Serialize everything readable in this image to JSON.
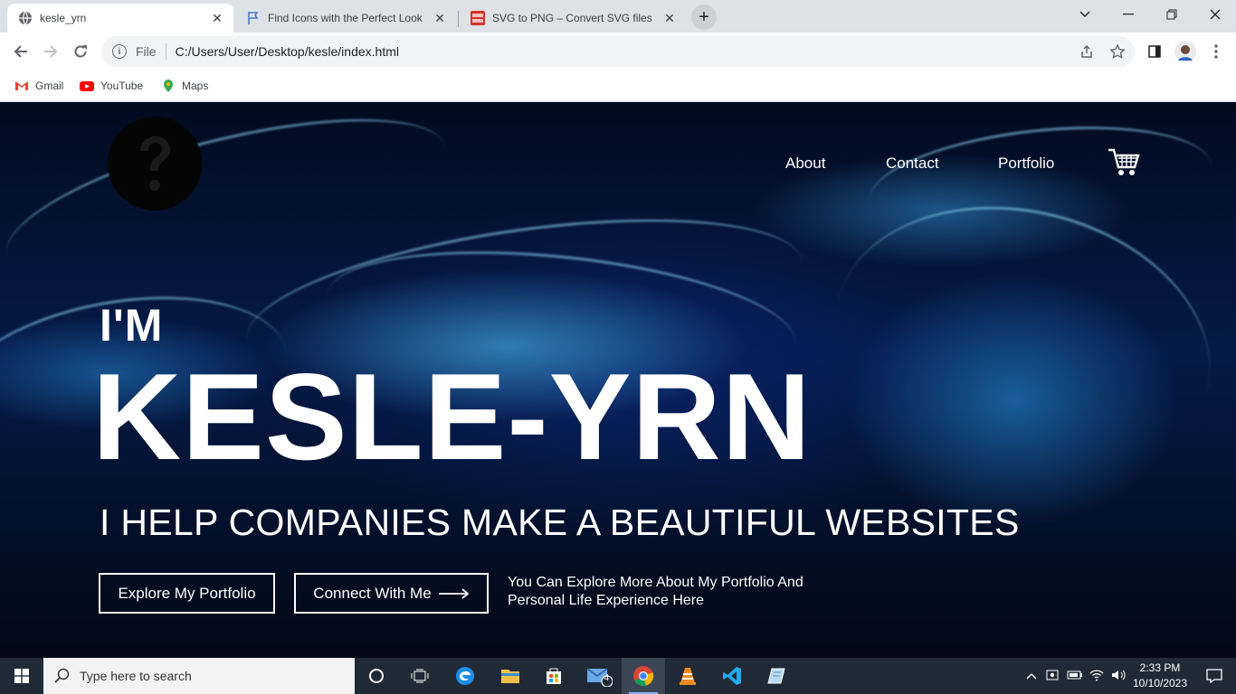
{
  "browser": {
    "tabs": [
      {
        "title": "kesle_yrn",
        "active": true
      },
      {
        "title": "Find Icons with the Perfect Look",
        "active": false
      },
      {
        "title": "SVG to PNG – Convert SVG files",
        "active": false
      }
    ],
    "address": {
      "scheme": "File",
      "url": "C:/Users/User/Desktop/kesle/index.html"
    },
    "bookmarks": [
      "Gmail",
      "YouTube",
      "Maps"
    ]
  },
  "page": {
    "nav": {
      "about": "About",
      "contact": "Contact",
      "portfolio": "Portfolio"
    },
    "hero": {
      "intro": "I'M",
      "name": "KESLE-YRN",
      "tagline": "I HELP COMPANIES MAKE A BEAUTIFUL WEBSITES",
      "explore_button": "Explore My Portfolio",
      "connect_button": "Connect With Me",
      "description": "You Can Explore More About My Portfolio And Personal Life Experience Here"
    }
  },
  "taskbar": {
    "search_placeholder": "Type here to search",
    "mail_badge": "4",
    "time": "2:33 PM",
    "date": "10/10/2023"
  }
}
